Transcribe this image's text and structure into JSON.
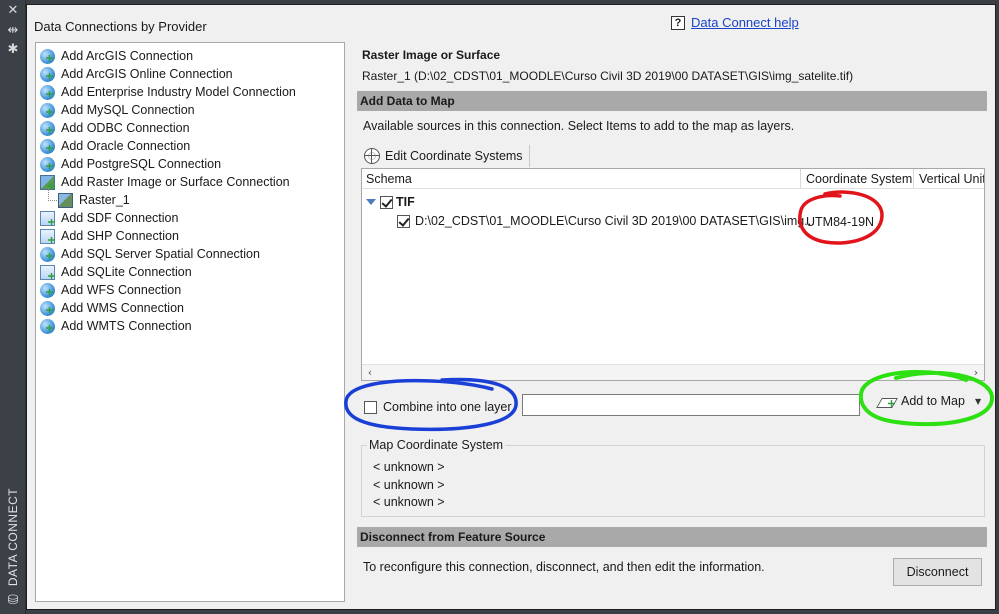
{
  "strip": {
    "label": "DATA CONNECT",
    "icons": [
      "close-icon",
      "collapse-icon",
      "settings-icon",
      "database-icon"
    ]
  },
  "left_panel": {
    "title": "Data Connections by Provider",
    "items": [
      {
        "label": "Add ArcGIS Connection",
        "icon": "globe-icon"
      },
      {
        "label": "Add ArcGIS Online Connection",
        "icon": "globe-icon"
      },
      {
        "label": "Add Enterprise Industry Model Connection",
        "icon": "globe-icon"
      },
      {
        "label": "Add MySQL Connection",
        "icon": "globe-icon"
      },
      {
        "label": "Add ODBC Connection",
        "icon": "globe-icon"
      },
      {
        "label": "Add Oracle Connection",
        "icon": "globe-icon"
      },
      {
        "label": "Add PostgreSQL Connection",
        "icon": "globe-icon"
      },
      {
        "label": "Add Raster Image or Surface Connection",
        "icon": "raster-icon"
      },
      {
        "label": "Raster_1",
        "icon": "raster-layer-icon",
        "child": true
      },
      {
        "label": "Add SDF Connection",
        "icon": "file-icon"
      },
      {
        "label": "Add SHP Connection",
        "icon": "file-icon"
      },
      {
        "label": "Add SQL Server Spatial Connection",
        "icon": "globe-icon"
      },
      {
        "label": "Add SQLite Connection",
        "icon": "file-icon"
      },
      {
        "label": "Add WFS Connection",
        "icon": "globe-icon"
      },
      {
        "label": "Add WMS Connection",
        "icon": "globe-icon"
      },
      {
        "label": "Add WMTS Connection",
        "icon": "globe-icon"
      }
    ]
  },
  "help": {
    "icon": "?",
    "link": "Data Connect help"
  },
  "source": {
    "title": "Raster Image or Surface",
    "path": "Raster_1 (D:\\02_CDST\\01_MOODLE\\Curso Civil 3D 2019\\00 DATASET\\GIS\\img_satelite.tif)"
  },
  "add_data": {
    "header": "Add Data to Map",
    "instructions": "Available sources in this connection.  Select Items to add to the map as layers.",
    "edit_cs_label": "Edit Coordinate Systems",
    "columns": [
      "Schema",
      "Coordinate System",
      "Vertical Unit"
    ],
    "schema": {
      "name": "TIF",
      "checked": true,
      "items": [
        {
          "name": "D:\\02_CDST\\01_MOODLE\\Curso Civil 3D 2019\\00 DATASET\\GIS\\img...",
          "cs": "UTM84-19N",
          "checked": true
        }
      ]
    },
    "scroll_left": "‹",
    "scroll_right": "›",
    "combine_label": "Combine into one layer",
    "combine_checked": false,
    "layer_name_value": "",
    "add_to_map_label": "Add to Map",
    "add_to_map_caret": "▼"
  },
  "map_cs": {
    "title": "Map Coordinate System",
    "lines": [
      "< unknown >",
      "< unknown >",
      "< unknown >"
    ]
  },
  "disconnect": {
    "header": "Disconnect from Feature Source",
    "text": "To reconfigure this connection, disconnect, and then edit the information.",
    "button": "Disconnect"
  },
  "annotation_colors": {
    "red": "#e0141a",
    "blue": "#1a3fd6",
    "green": "#2ce012"
  }
}
